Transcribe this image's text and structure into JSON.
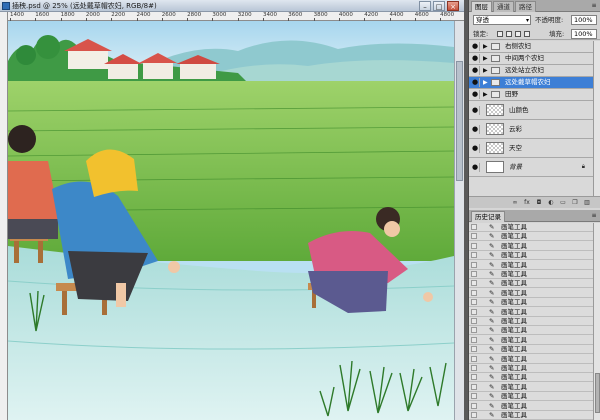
{
  "document": {
    "title": "插秧.psd @ 25% (远处戴草帽农妇, RGB/8#)",
    "ruler_labels": [
      "1400",
      "1600",
      "1800",
      "2000",
      "2200",
      "2400",
      "2600",
      "2800",
      "3000",
      "3200",
      "3400",
      "3600",
      "3800",
      "4000",
      "4200",
      "4400",
      "4600",
      "4800"
    ],
    "window_buttons": {
      "minimize": "–",
      "maximize": "□",
      "close": "×"
    }
  },
  "layers_panel": {
    "tabs": [
      "图层",
      "通道",
      "路径"
    ],
    "blend_mode": "穿透",
    "opacity_label": "不透明度:",
    "opacity_value": "100%",
    "lock_label": "锁定:",
    "fill_label": "填充:",
    "fill_value": "100%",
    "layers": [
      {
        "name": "右侧农妇",
        "type": "group",
        "selected": false
      },
      {
        "name": "中间两个农妇",
        "type": "group",
        "selected": false
      },
      {
        "name": "远处站立农妇",
        "type": "group",
        "selected": false
      },
      {
        "name": "远处戴草帽农妇",
        "type": "group",
        "selected": true
      },
      {
        "name": "田野",
        "type": "group",
        "selected": false
      },
      {
        "name": "山颜色",
        "type": "layer",
        "selected": false
      },
      {
        "name": "云彩",
        "type": "layer",
        "selected": false
      },
      {
        "name": "天空",
        "type": "layer",
        "selected": false
      },
      {
        "name": "背景",
        "type": "background",
        "selected": false
      }
    ],
    "bottom_icons": [
      "link-icon",
      "fx-icon",
      "mask-icon",
      "adjustment-icon",
      "folder-icon",
      "new-layer-icon",
      "trash-icon"
    ]
  },
  "history_panel": {
    "tabs": [
      "历史记录"
    ],
    "entries": [
      "画笔工具",
      "画笔工具",
      "画笔工具",
      "画笔工具",
      "画笔工具",
      "画笔工具",
      "画笔工具",
      "画笔工具",
      "画笔工具",
      "画笔工具",
      "画笔工具",
      "画笔工具",
      "画笔工具",
      "画笔工具",
      "画笔工具",
      "画笔工具",
      "画笔工具",
      "画笔工具",
      "画笔工具",
      "画笔工具",
      "画笔工具"
    ]
  },
  "colors": {
    "selection": "#3d7fd6",
    "sky": "#b9e0f2",
    "field": "#7fc14a",
    "water": "#bfe6e8"
  }
}
